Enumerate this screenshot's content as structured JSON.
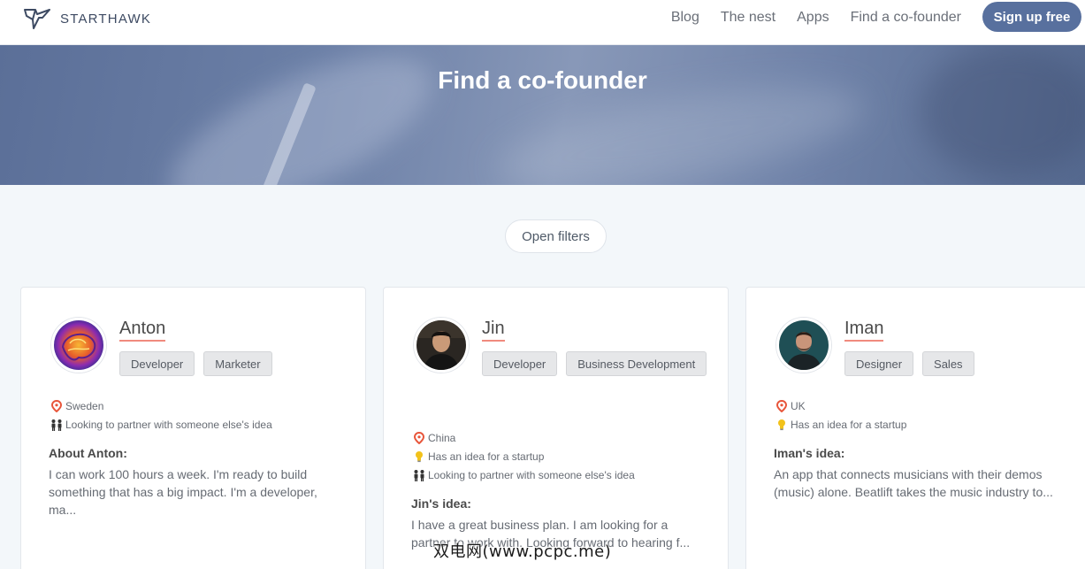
{
  "brand": {
    "name": "STARTHAWK"
  },
  "nav": {
    "items": [
      "Blog",
      "The nest",
      "Apps",
      "Find a co-founder"
    ],
    "signup_label": "Sign up free"
  },
  "hero": {
    "title": "Find a co-founder"
  },
  "filters": {
    "label": "Open filters"
  },
  "cards": [
    {
      "name": "Anton",
      "tags": [
        "Developer",
        "Marketer"
      ],
      "location": "Sweden",
      "idea_status": null,
      "partner": "Looking to partner with someone else's idea",
      "about_title": "About Anton:",
      "about_text": "I can work 100 hours a week. I'm ready to build something that has a big impact. I'm a developer, ma..."
    },
    {
      "name": "Jin",
      "tags": [
        "Developer",
        "Business Development"
      ],
      "location": "China",
      "idea_status": "Has an idea for a startup",
      "partner": "Looking to partner with someone else's idea",
      "about_title": "Jin's idea:",
      "about_text": "I have a great business plan. I am looking for a partner to work with. Looking forward to hearing f..."
    },
    {
      "name": "Iman",
      "tags": [
        "Designer",
        "Sales"
      ],
      "location": "UK",
      "idea_status": "Has an idea for a startup",
      "partner": null,
      "about_title": "Iman's idea:",
      "about_text": "An app that connects musicians with their demos (music) alone. Beatlift takes the music industry to..."
    }
  ],
  "icons": {
    "location": "map-pin-icon",
    "idea": "lightbulb-icon",
    "partner": "people-icon"
  },
  "colors": {
    "accent": "#58709e",
    "name_underline": "#f08a7e",
    "pin": "#e8553a",
    "bulb": "#f2c21b"
  },
  "watermark": "双电网(www.pcpc.me)"
}
